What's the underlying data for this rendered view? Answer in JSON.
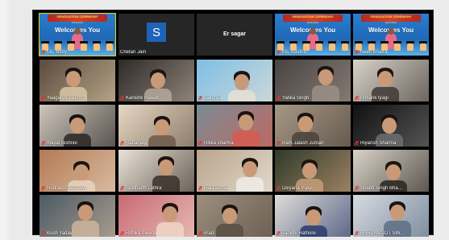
{
  "participants": [
    {
      "name": "Ms. Betty",
      "type": "banner",
      "welcome": "Welcomes You",
      "ribbon": "GRADUATION CEREMONY",
      "year": "2020-2021",
      "active": true
    },
    {
      "name": "Chetan Jain",
      "type": "avatar",
      "initial": "S"
    },
    {
      "name": "Er sagar",
      "type": "namecard"
    },
    {
      "name": "Ms. Aastha",
      "type": "banner",
      "welcome": "Welcomes You",
      "ribbon": "GRADUATION CEREMONY",
      "year": "2020-2021"
    },
    {
      "name": "Neeti Bhatra",
      "type": "banner",
      "welcome": "Welcomes You",
      "ribbon": "GRADUATION CEREMONY",
      "year": "2020-2021"
    },
    {
      "name": "Yaagarya vaishn...",
      "type": "video",
      "bg": "#5b4a3c",
      "accent": "#d8c7a5"
    },
    {
      "name": "Kanishk Rawat",
      "type": "video",
      "bg": "#2e2a27",
      "accent": "#b5a89b"
    },
    {
      "name": "Lakshya",
      "type": "video",
      "bg": "#7fbfe6",
      "accent": "#e8e0d2"
    },
    {
      "name": "Yatika Singh",
      "type": "video",
      "bg": "#494442",
      "accent": "#9b8f86"
    },
    {
      "name": "Himank tyagi",
      "type": "video",
      "bg": "#d8d2c8",
      "accent": "#3f3a35"
    },
    {
      "name": "Inayat Bishnoi",
      "type": "video",
      "bg": "#cfc6bd",
      "accent": "#2b2724"
    },
    {
      "name": "Rahanjay",
      "type": "video",
      "bg": "#e4d7c4",
      "accent": "#6d5a48"
    },
    {
      "name": "Ritika sharma",
      "type": "video",
      "bg": "#7a8c95",
      "accent": "#d75b4f"
    },
    {
      "name": "Ram Jalash Juman",
      "type": "video",
      "bg": "#a79886",
      "accent": "#4c4238"
    },
    {
      "name": "Riyansh Sharma",
      "type": "video",
      "bg": "#111111",
      "accent": "#6e6e6e"
    },
    {
      "name": "Rudraksh Mahaw...",
      "type": "video",
      "bg": "#b47a52",
      "accent": "#e7d4c0"
    },
    {
      "name": "Siddharth Luthra",
      "type": "video",
      "bg": "#e9e2d6",
      "accent": "#3a3029"
    },
    {
      "name": "Ria Dayma",
      "type": "video",
      "bg": "#b9a58b",
      "accent": "#f0ece6"
    },
    {
      "name": "Divyana Vijay",
      "type": "video",
      "bg": "#2f3a2a",
      "accent": "#c79d79"
    },
    {
      "name": "Shabd Singh Bha...",
      "type": "video",
      "bg": "#d9d3c8",
      "accent": "#2a2520"
    },
    {
      "name": "Kush Yadav",
      "type": "video",
      "bg": "#4b5a66",
      "accent": "#cdb59b"
    },
    {
      "name": "Rithika meena",
      "type": "video",
      "bg": "#c86b76",
      "accent": "#f0d6c6"
    },
    {
      "name": "iPad",
      "type": "video",
      "bg": "#9d8e7d",
      "accent": "#5a4f45"
    },
    {
      "name": "Tanishi Rathore",
      "type": "video",
      "bg": "#e0ddd9",
      "accent": "#2a3b6b"
    },
    {
      "name": "BHRANVIJOT SIN...",
      "type": "video",
      "bg": "#d6dbe1",
      "accent": "#5d6f86"
    }
  ],
  "colors": {
    "active_outline": "#e8d21a",
    "muted_icon": "#e5312c",
    "avatar_bg": "#1e63b7"
  },
  "icons": {
    "muted": "mic-muted-icon"
  }
}
